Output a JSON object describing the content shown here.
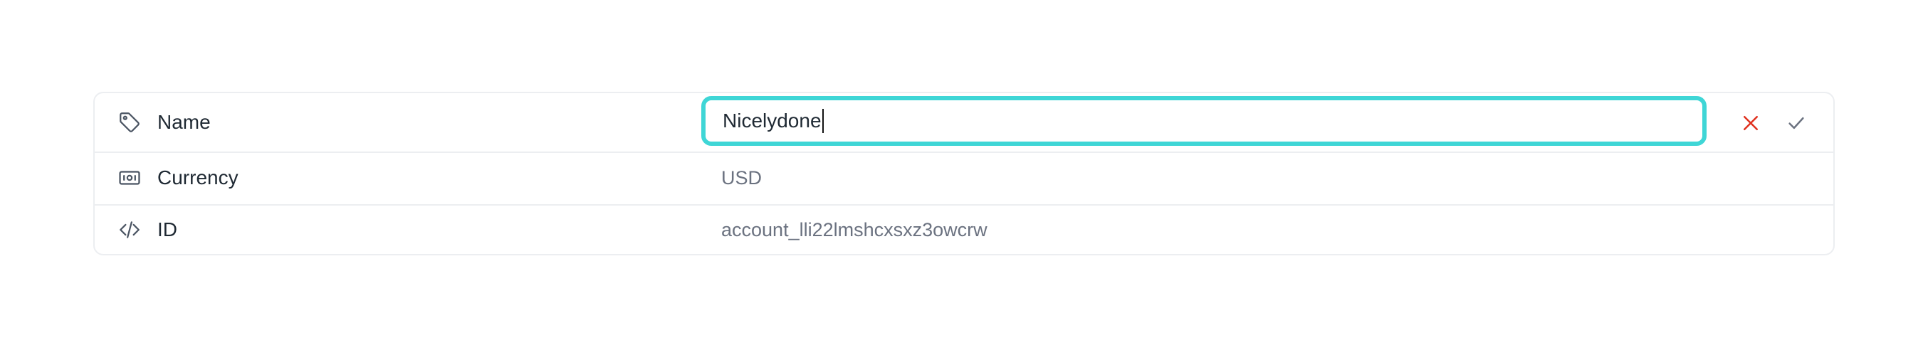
{
  "fields": [
    {
      "label": "Name",
      "icon": "tag-icon",
      "value": "Nicelydone",
      "editing": true
    },
    {
      "label": "Currency",
      "icon": "banknote-icon",
      "value": "USD"
    },
    {
      "label": "ID",
      "icon": "code-icon",
      "value": "account_lli22lmshcxsxz3owcrw"
    }
  ],
  "actions": {
    "cancel_icon": "close-icon",
    "confirm_icon": "check-icon"
  },
  "colors": {
    "focus_ring": "#3fd6d6",
    "cancel": "#e0301e",
    "confirm": "#6b7280",
    "label_text": "#1f2933",
    "value_text": "#6b7280",
    "border": "#eceef1"
  }
}
